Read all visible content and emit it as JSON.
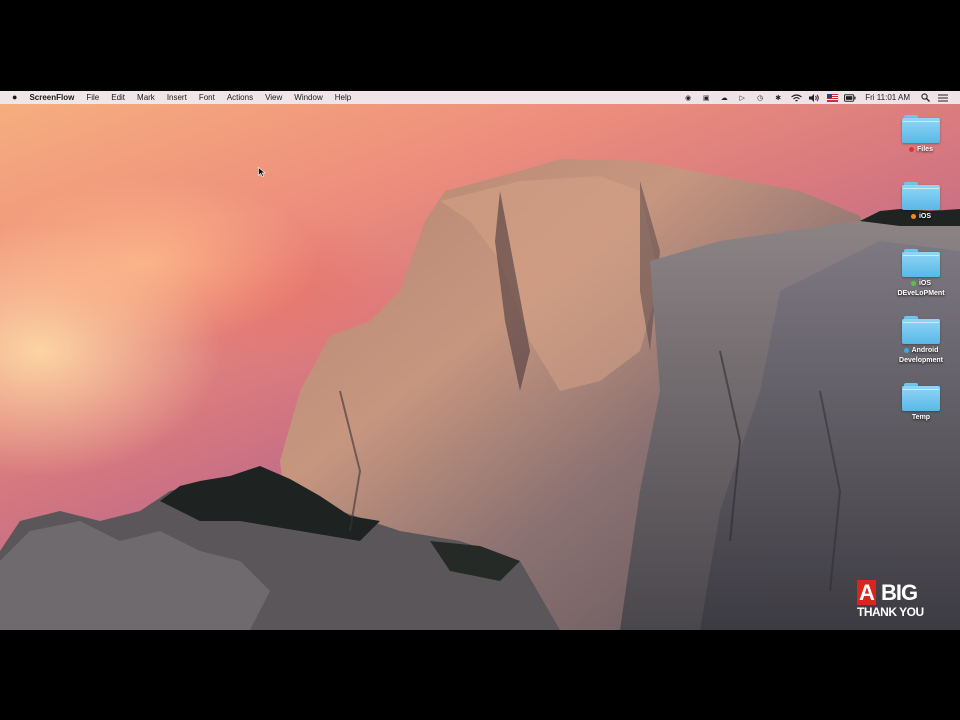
{
  "menubar": {
    "apple": "",
    "app_name": "ScreenFlow",
    "menus": [
      "File",
      "Edit",
      "Mark",
      "Insert",
      "Font",
      "Actions",
      "View",
      "Window",
      "Help"
    ],
    "clock": "Fri 11:01 AM"
  },
  "desktop": {
    "icons": [
      {
        "label": "Files",
        "tag_color": "#e2332b"
      },
      {
        "label": "iOS",
        "tag_color": "#f28a1c"
      },
      {
        "label_lines": [
          "iOS",
          "DEveLoPMent"
        ],
        "tag_color": "#58c447"
      },
      {
        "label_lines": [
          "Android",
          "Development"
        ],
        "tag_color": "#3aa9e6"
      },
      {
        "label": "Temp"
      }
    ]
  },
  "watermark": {
    "top": "A BIG",
    "bottom": "THANK YOU"
  }
}
